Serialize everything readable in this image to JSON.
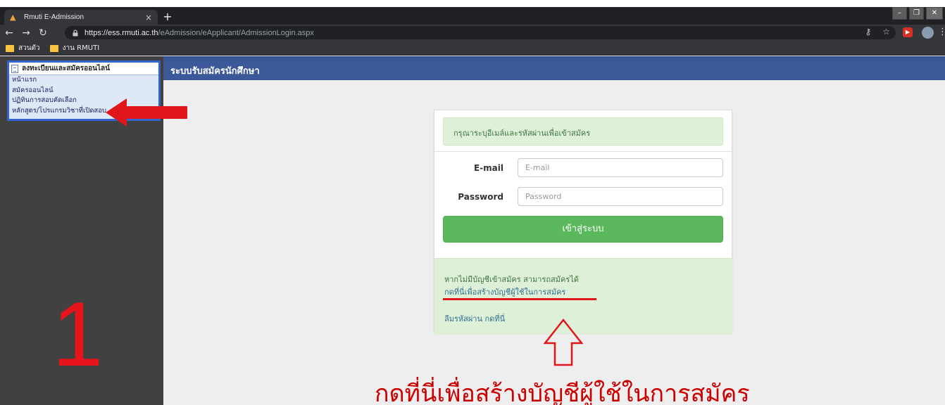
{
  "browser": {
    "tab_title": "Rmuti E-Admission",
    "tab_close": "×",
    "new_tab": "+",
    "url_host": "https://ess.rmuti.ac.th",
    "url_path": "/eAdmission/eApplicant/AdmissionLogin.aspx",
    "bookmarks": [
      {
        "label": "สวนตัว"
      },
      {
        "label": "งาน RMUTI"
      }
    ]
  },
  "sidebar": {
    "title": "ลงทะเบียนและสมัครออนไลน์",
    "items": [
      {
        "label": "หน้าแรก"
      },
      {
        "label": "สมัครออนไลน์"
      },
      {
        "label": "ปฏิทินการสอบคัดเลือก"
      },
      {
        "label": "หลักสูตร/โปรแกรมวิชาที่เปิดสอบ"
      }
    ]
  },
  "header": {
    "title": "ระบบรับสมัครนักศึกษา"
  },
  "login": {
    "instruction": "กรุณาระบุอีเมล์และรหัสผ่านเพื่อเข้าสมัคร",
    "email_label": "E-mail",
    "email_placeholder": "E-mail",
    "password_label": "Password",
    "password_placeholder": "Password",
    "submit_label": "เข้าสู่ระบบ",
    "no_account_text": "หากไม่มีบัญชีเข้าสมัคร สามารถสมัครได้",
    "create_account_link": "กดที่นี่เพื่อสร้างบัญชีผู้ใช้ในการสมัคร",
    "forgot_password_link": "ลืมรหัสผ่าน กดที่นี่"
  },
  "annotations": {
    "step_number": "1",
    "caption": "กดที่นี่เพื่อสร้างบัญชีผู้ใช้ในการสมัคร"
  },
  "colors": {
    "header_blue": "#3b5998",
    "login_green": "#5cb85c",
    "info_green_bg": "#dff0d8",
    "annotation_red": "#e8141b"
  }
}
